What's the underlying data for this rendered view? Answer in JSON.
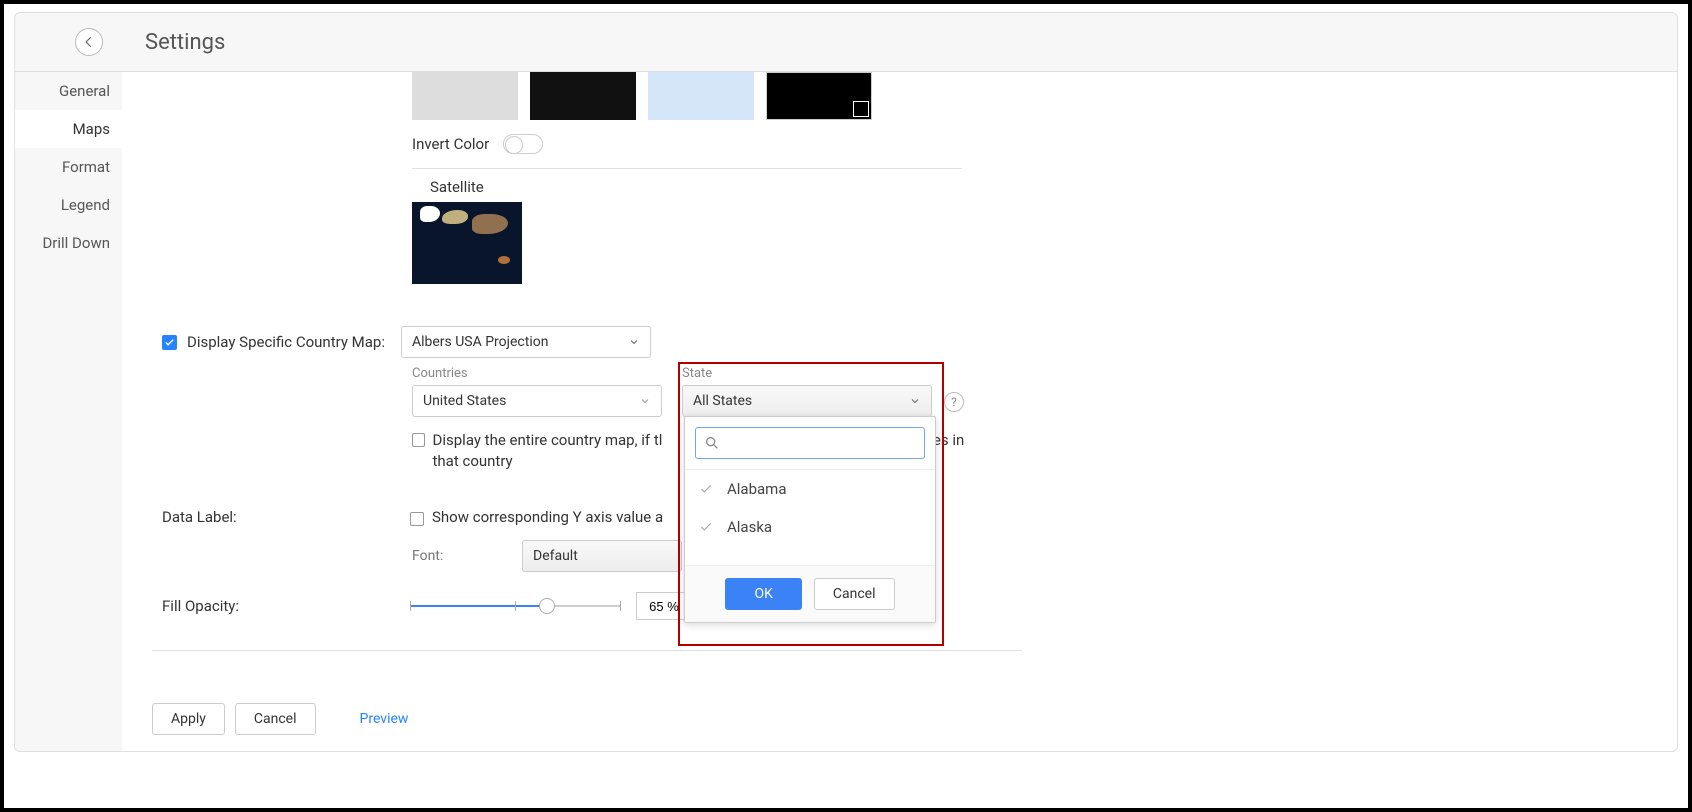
{
  "header": {
    "title": "Settings"
  },
  "sidebar": {
    "items": [
      {
        "label": "General"
      },
      {
        "label": "Maps"
      },
      {
        "label": "Format"
      },
      {
        "label": "Legend"
      },
      {
        "label": "Drill Down"
      }
    ]
  },
  "themes": {
    "invert_label": "Invert Color",
    "satellite_label": "Satellite"
  },
  "display_country": {
    "checkbox_label": "Display Specific Country Map:",
    "projection_value": "Albers USA Projection",
    "countries_label": "Countries",
    "countries_value": "United States",
    "state_label": "State",
    "state_value": "All States",
    "entire_label": "Display the entire country map, if the data doesn't match any states in that country",
    "entire_label_trunc_left": "Display the entire country map, if tl",
    "entire_label_trunc_right": "ates in that country"
  },
  "data_label": {
    "title": "Data Label:",
    "show_y_label": "Show corresponding Y axis value a",
    "font_label": "Font:",
    "font_value": "Default"
  },
  "opacity": {
    "title": "Fill Opacity:",
    "value": "65 %"
  },
  "footer": {
    "apply": "Apply",
    "cancel": "Cancel",
    "preview": "Preview"
  },
  "dropdown": {
    "ok": "OK",
    "cancel": "Cancel",
    "items": [
      {
        "label": "Alabama"
      },
      {
        "label": "Alaska"
      }
    ]
  },
  "help": {
    "q": "?"
  }
}
